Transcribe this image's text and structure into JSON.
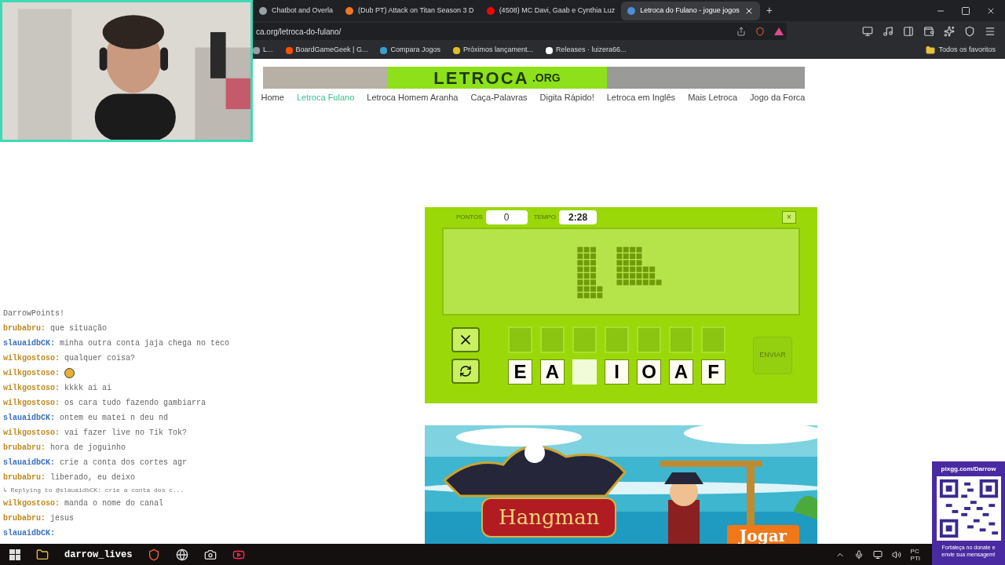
{
  "browser": {
    "tabs": [
      {
        "title": "Chatbot and Overla",
        "selected": false,
        "color": "#9aa0a6"
      },
      {
        "title": "(Dub PT) Attack on Titan Season 3 D",
        "selected": false,
        "color": "#f47521"
      },
      {
        "title": "(4508) MC Davi, Gaab e Cynthia Luz",
        "selected": false,
        "color": "#ff0000"
      },
      {
        "title": "Letroca do Fulano - jogue jogos",
        "selected": true,
        "color": "#4a90d9"
      }
    ],
    "new_tab": "+",
    "address": "ca.org/letroca-do-fulano/",
    "bookmarks": [
      {
        "label": "L...",
        "color": "#9aa0a6"
      },
      {
        "label": "BoardGameGeek | G...",
        "color": "#ff5100"
      },
      {
        "label": "Compara Jogos",
        "color": "#3aa0c8"
      },
      {
        "label": "Próximos lançament...",
        "color": "#e0c020"
      },
      {
        "label": "Releases · luizera66...",
        "color": "#ffffff"
      }
    ],
    "all_bookmarks": "Todos os favoritos"
  },
  "site": {
    "logo": "LETROCA",
    "logo_sub": ".ORG",
    "nav": [
      {
        "label": "Home",
        "selected": false
      },
      {
        "label": "Letroca Fulano",
        "selected": true
      },
      {
        "label": "Letroca Homem Aranha",
        "selected": false
      },
      {
        "label": "Caça-Palavras",
        "selected": false
      },
      {
        "label": "Digita Rápido!",
        "selected": false
      },
      {
        "label": "Letroca em Inglês",
        "selected": false
      },
      {
        "label": "Mais Letroca",
        "selected": false
      },
      {
        "label": "Jogo da Forca",
        "selected": false
      }
    ]
  },
  "game": {
    "score_label": "PONTOS",
    "score": "0",
    "time_label": "TEMPO",
    "time": "2:28",
    "close": "×",
    "slots": [
      {
        "filled": false
      },
      {
        "filled": false
      },
      {
        "filled": false
      },
      {
        "filled": false
      },
      {
        "filled": false
      },
      {
        "filled": false
      },
      {
        "filled": false
      }
    ],
    "tiles": [
      {
        "letter": "E",
        "used": false
      },
      {
        "letter": "A",
        "used": false
      },
      {
        "used": true
      },
      {
        "letter": "I",
        "used": false
      },
      {
        "letter": "O",
        "used": false
      },
      {
        "letter": "A",
        "used": false
      },
      {
        "letter": "F",
        "used": false
      }
    ],
    "send": "ENVIAR"
  },
  "banner": {
    "title": "Hangman",
    "button": "Jogar"
  },
  "chat": {
    "messages": [
      {
        "kind": "system",
        "text": "DarrowPoints!"
      },
      {
        "kind": "message",
        "user": "brubabru:",
        "color": "#c08a20",
        "text": "que situação"
      },
      {
        "kind": "message",
        "user": "slauaidbCK:",
        "color": "#3a6fc0",
        "text": "minha outra conta jaja chega no teco"
      },
      {
        "kind": "message",
        "user": "wilkgostoso:",
        "color": "#c08a20",
        "text": "qualquer coisa?"
      },
      {
        "kind": "emoji",
        "user": "wilkgostoso:",
        "color": "#c08a20"
      },
      {
        "kind": "message",
        "user": "wilkgostoso:",
        "color": "#c08a20",
        "text": "kkkk ai ai"
      },
      {
        "kind": "message",
        "user": "wilkgostoso:",
        "color": "#c08a20",
        "text": "os cara tudo fazendo gambiarra"
      },
      {
        "kind": "message",
        "user": "slauaidbCK:",
        "color": "#3a6fc0",
        "text": "ontem eu matei n deu nd"
      },
      {
        "kind": "message",
        "user": "wilkgostoso:",
        "color": "#c08a20",
        "text": "vai fazer live no Tik Tok?"
      },
      {
        "kind": "message",
        "user": "brubabru:",
        "color": "#c08a20",
        "text": "hora de joguinho"
      },
      {
        "kind": "message",
        "user": "slauaidbCK:",
        "color": "#3a6fc0",
        "text": "crie a conta dos cortes agr"
      },
      {
        "kind": "message",
        "user": "brubabru:",
        "color": "#c08a20",
        "text": "liberado, eu deixo"
      },
      {
        "kind": "reply",
        "text": "↳ Replying to @slauaidbCK: crie a conta dos c..."
      },
      {
        "kind": "message",
        "user": "wilkgostoso:",
        "color": "#c08a20",
        "text": "manda o nome do canal"
      },
      {
        "kind": "message",
        "user": "brubabru:",
        "color": "#c08a20",
        "text": "jesus"
      },
      {
        "kind": "message",
        "user": "slauaidbCK:",
        "color": "#3a6fc0"
      }
    ]
  },
  "overlay": {
    "channel": "darrow_lives"
  },
  "donation": {
    "url": "pixgg.com/Darrow",
    "text": "Fortaleça no donate e envie sua mensagem!"
  },
  "taskbar": {
    "tray_text": [
      "PC",
      "PTI"
    ]
  }
}
